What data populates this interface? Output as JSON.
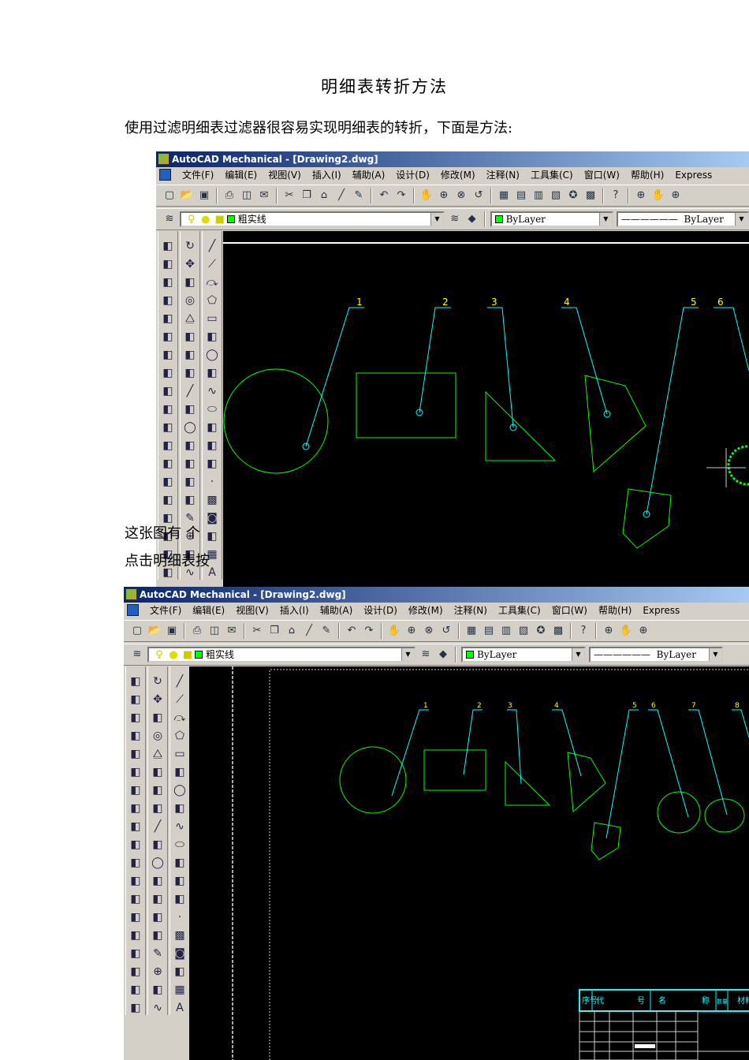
{
  "doc": {
    "title": "明细表转折方法",
    "intro": "使用过滤明细表过滤器很容易实现明细表的转折，下面是方法:",
    "line1": "这张图有 个",
    "line2": "点击明细表按"
  },
  "app": {
    "window_title": "AutoCAD Mechanical - [Drawing2.dwg]",
    "menus": [
      "文件(F)",
      "编辑(E)",
      "视图(V)",
      "插入(I)",
      "辅助(A)",
      "设计(D)",
      "修改(M)",
      "注释(N)",
      "工具集(C)",
      "窗口(W)",
      "帮助(H)",
      "Express"
    ],
    "layer_name": "粗实线",
    "color_value": "ByLayer",
    "linetype_value": "ByLayer",
    "toolbar_icons": [
      "new-icon",
      "open-icon",
      "save-icon",
      "|",
      "print-icon",
      "preview-icon",
      "publish-icon",
      "|",
      "cut-icon",
      "copy-icon",
      "paste-icon",
      "match-icon",
      "brush-icon",
      "|",
      "undo-icon",
      "redo-icon",
      "|",
      "pan-icon",
      "zoom-realtime-icon",
      "zoom-window-icon",
      "zoom-previous-icon",
      "|",
      "properties-icon",
      "design-center-icon",
      "tool-palette-icon",
      "sheet-set-icon",
      "markup-icon",
      "calculator-icon",
      "|",
      "help-icon",
      "|",
      "zoom-icon",
      "pan2-icon",
      "zoom2-icon"
    ],
    "left_col_a": [
      "mech-1",
      "mech-2",
      "mech-3",
      "mech-4",
      "mech-5",
      "mech-6",
      "mech-7",
      "mech-8",
      "mech-9",
      "mech-10",
      "mech-11",
      "mech-12",
      "mech-13",
      "mech-14",
      "mech-15",
      "mech-16",
      "mech-17",
      "mech-18",
      "mech-19"
    ],
    "left_col_b": [
      "rotate-icon",
      "move-icon",
      "copy-obj-icon",
      "offset-icon",
      "mirror-icon",
      "stretch-icon",
      "trim-icon",
      "extend-icon",
      "line-icon",
      "dim-icon",
      "circle-icon",
      "rect-icon",
      "array-icon",
      "fillet-icon",
      "chamfer-icon",
      "brush-icon",
      "target-icon",
      "center-icon",
      "spline-icon"
    ],
    "left_col_c": [
      "line-icon",
      "ray-icon",
      "arc-icon",
      "polygon-icon",
      "rectangle-icon",
      "arc2-icon",
      "circle-icon",
      "revcloud-icon",
      "spline-icon",
      "ellipse-icon",
      "ellipse-arc-icon",
      "insert-icon",
      "block-icon",
      "point-icon",
      "hatch-icon",
      "camera-icon",
      "region-icon",
      "table-icon",
      "text-icon"
    ],
    "colors": {
      "canvas": "#000000",
      "shape": "#00ff00",
      "leader": "#00ffff",
      "balloon": "#ffff00"
    }
  },
  "drawing1": {
    "balloons": [
      "1",
      "2",
      "3",
      "4",
      "5",
      "6"
    ]
  },
  "drawing2": {
    "balloons": [
      "1",
      "2",
      "3",
      "4",
      "5",
      "6",
      "7",
      "8"
    ],
    "bom_headers": [
      "序号",
      "代",
      "号",
      "名",
      "称",
      "数量",
      "材料"
    ]
  }
}
